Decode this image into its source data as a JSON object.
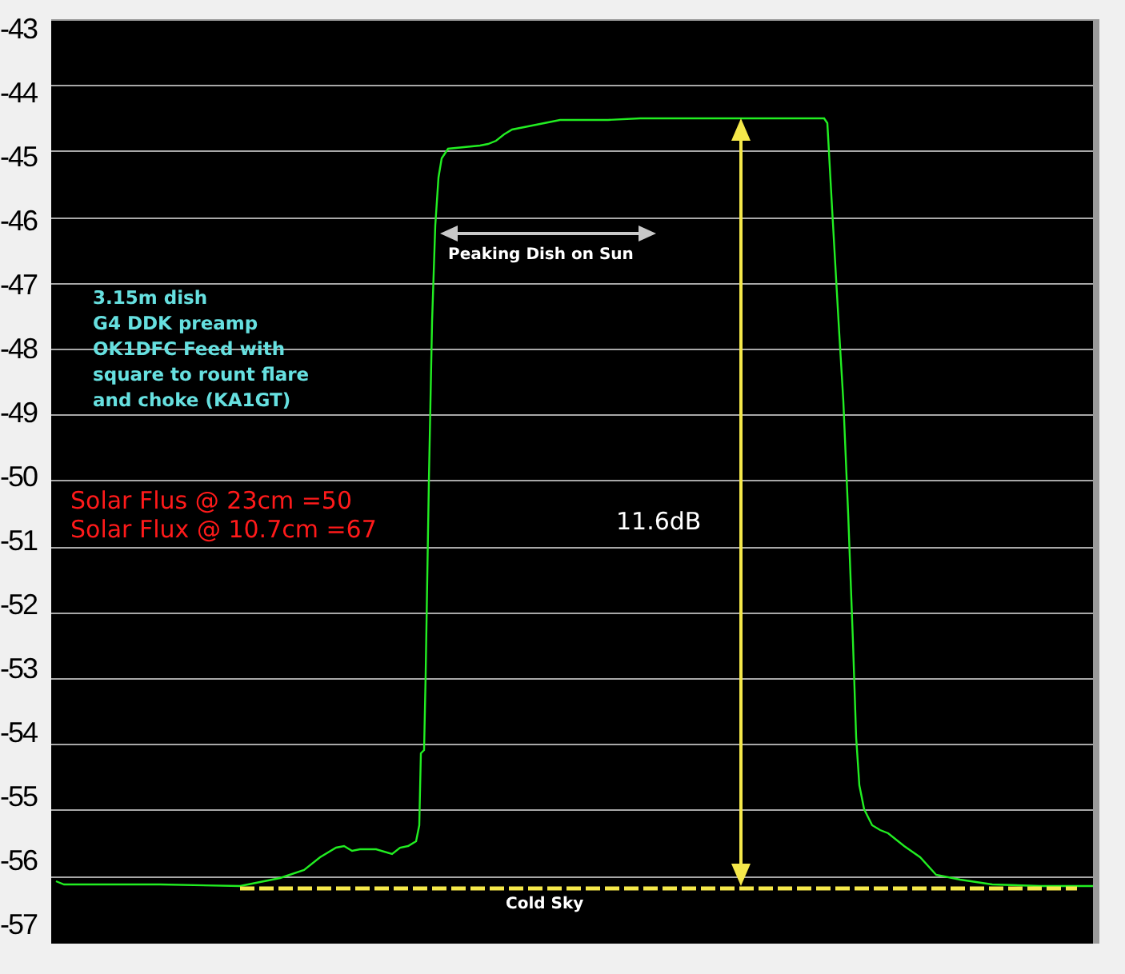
{
  "y_axis_labels": [
    "-43",
    "-44",
    "-45",
    "-46",
    "-47",
    "-48",
    "-49",
    "-50",
    "-51",
    "-52",
    "-53",
    "-54",
    "-55",
    "-56",
    "-57"
  ],
  "setup_notes": {
    "color": "#66e0e0",
    "lines": [
      "3.15m dish",
      "G4 DDK preamp",
      "OK1DFC Feed with",
      "square to rount flare",
      "and choke (KA1GT)"
    ]
  },
  "flux_notes": {
    "color": "#ff1a1a",
    "lines": [
      "Solar Flus @ 23cm =50",
      "Solar Flux @ 10.7cm =67"
    ]
  },
  "peaking_label": "Peaking Dish on Sun",
  "gain_label": "11.6dB",
  "baseline_label": "Cold Sky"
}
